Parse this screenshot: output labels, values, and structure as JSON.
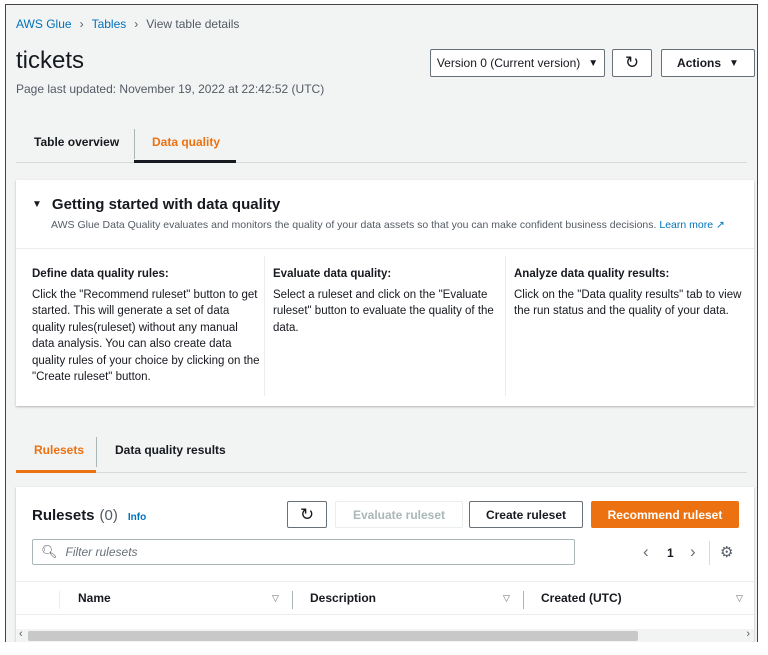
{
  "breadcrumb": [
    "AWS Glue",
    "Tables",
    "View table details"
  ],
  "title": "tickets",
  "last_updated": "Page last updated: November 19, 2022 at 22:42:52 (UTC)",
  "version_select": "Version 0 (Current version)",
  "actions_label": "Actions",
  "tabs": [
    "Table overview",
    "Data quality"
  ],
  "getting_started": {
    "heading": "Getting started with data quality",
    "description": "AWS Glue Data Quality evaluates and monitors the quality of your data assets so that you can make confident business decisions.",
    "learn_more": "Learn more",
    "columns": [
      {
        "title": "Define data quality rules:",
        "text": "Click the \"Recommend ruleset\" button to get started. This will generate a set of data quality rules(ruleset) without any manual data analysis. You can also create data quality rules of your choice by clicking on the \"Create ruleset\" button."
      },
      {
        "title": "Evaluate data quality:",
        "text": "Select a ruleset and click on the \"Evaluate ruleset\" button to evaluate the quality of the data."
      },
      {
        "title": "Analyze data quality results:",
        "text": "Click on the \"Data quality results\" tab to view the run status and the quality of your data."
      }
    ]
  },
  "sub_tabs": [
    "Rulesets",
    "Data quality results"
  ],
  "rulesets": {
    "title": "Rulesets",
    "count": "(0)",
    "info": "Info",
    "evaluate": "Evaluate ruleset",
    "create": "Create ruleset",
    "recommend": "Recommend ruleset",
    "filter_placeholder": "Filter rulesets",
    "page": "1",
    "columns": [
      "Name",
      "Description",
      "Created (UTC)"
    ]
  },
  "colors": {
    "accent": "#ec7211",
    "link": "#0073bb"
  }
}
